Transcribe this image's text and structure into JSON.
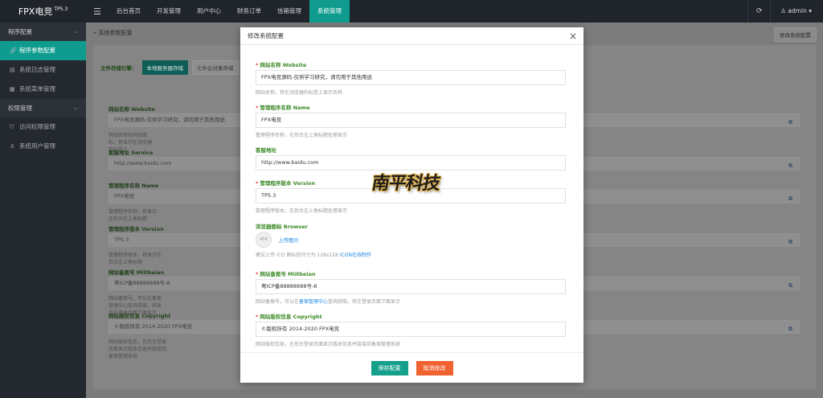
{
  "app": {
    "logo": "FPX电竞",
    "version": "TP5.3"
  },
  "topnav": {
    "items": [
      "后台首页",
      "开发管理",
      "用户中心",
      "财务订单",
      "信箱管理",
      "系统管理"
    ],
    "user": "admin"
  },
  "sidebar": {
    "groups": [
      {
        "label": "程序配置",
        "items": [
          "程序参数配置",
          "系统日志管理",
          "系统菜单管理"
        ]
      },
      {
        "label": "权限管理",
        "items": [
          "访问权限管理",
          "系统用户管理"
        ]
      }
    ]
  },
  "main": {
    "breadcrumb": "系统参数配置",
    "edit_button": "修改系统配置",
    "storage_label": "文件存储引擎：",
    "storage_tabs": [
      "本地服务器存储",
      "七牛云对象存储"
    ],
    "fields": [
      {
        "label": "网站名称 Website",
        "value": "FPX电竞源码-仅供学习研究，请勿用于其他用途",
        "help": "网站名称及网站图标，将显示在浏览器的标签上"
      },
      {
        "label": "客服地址 Service",
        "value": "http://www.baidu.com",
        "help": ""
      },
      {
        "label": "管理程序名称 Name",
        "value": "FPX电竞",
        "help": "管理程序名称，将显示在后台左上角标题"
      },
      {
        "label": "管理程序版本 Version",
        "value": "TP5.3",
        "help": "管理程序版本，将显示在后台左上角标题"
      },
      {
        "label": "网站备案号 Miitbeian",
        "value": "粤ICP备88888888号-8",
        "help": "网站备案号，可以在备案管理中心查询获取，将显示在登录页面下面显示"
      },
      {
        "label": "网站版权信息 Copyright",
        "value": "©版权所有 2014-2020 FPX电竞",
        "help": "网站版权信息，在后台登录页面显示版本信息并链接到备案管理系统"
      }
    ]
  },
  "modal": {
    "title": "修改系统配置",
    "fields": {
      "website": {
        "label": "网站名称 Website",
        "value": "FPX电竞源码-仅供学习研究，请勿用于其他用途",
        "help": "网站名称，将在浏览器的标签上显示名称"
      },
      "name": {
        "label": "管理程序名称 Name",
        "value": "FPX电竞",
        "help": "管理程序名称，在后台左上角标题处理显示"
      },
      "service": {
        "label": "客服地址",
        "value": "http://www.baidu.com"
      },
      "version": {
        "label": "管理程序版本 Version",
        "value": "TP5.3",
        "help": "管理程序版本，在后台左上角标题处理显示"
      },
      "browser": {
        "label": "浏览器图标 Browser",
        "placeholder_text": "404",
        "upload": "上传图片",
        "help_prefix": "建议上传 ICO 图标的尺寸为 128x128 ",
        "help_link": "ICON在线制作"
      },
      "miitbeian": {
        "label": "网站备案号 Miitbeian",
        "value": "粤ICP备88888888号-8",
        "help_prefix": "网站备案号，可以在",
        "help_link": "备案管理中心",
        "help_suffix": "查询获取，将在登录页面下面显示"
      },
      "copyright": {
        "label": "网站版权信息 Copyright",
        "value": "©版权所有 2014-2020 FPX电竞",
        "help": "网站版权信息，在后台登录页面显示版本信息并链接到备案管理系统"
      }
    },
    "save": "保存配置",
    "cancel": "取消修改"
  },
  "watermark": "南平科技",
  "colors": {
    "accent": "#0f9c8f",
    "save": "#14a08a",
    "cancel": "#f0622f",
    "label_green": "#3d8b28",
    "link": "#1e88e5"
  }
}
